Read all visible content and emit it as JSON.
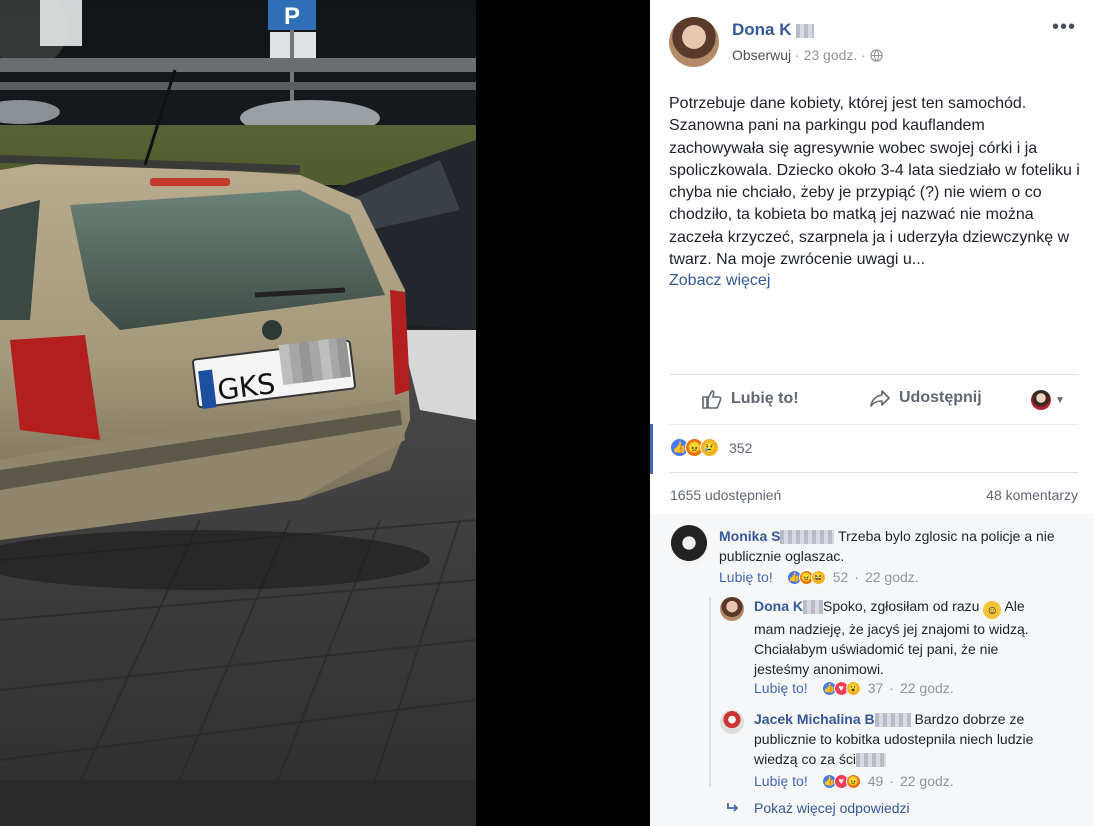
{
  "post": {
    "author_name": "Dona K",
    "follow_label": "Obserwuj",
    "time": "23 godz.",
    "text": "Potrzebuje dane kobiety, której jest ten samochód. Szanowna pani na parkingu pod kauflandem zachowywała się agresywnie wobec swojej córki i ja spoliczkowala. Dziecko około 3-4 lata siedziało w foteliku i chyba nie chciało, żeby je przypiąć (?) nie wiem o co chodziło, ta kobieta bo matką jej nazwać nie można zaczeła krzyczeć, szarpnela ja i uderzyła dziewczynkę w twarz. Na moje zwrócenie uwagi u...",
    "see_more": "Zobacz więcej",
    "like_label": "Lubię to!",
    "share_label": "Udostępnij",
    "reaction_count": "352",
    "shares_count": "1655 udostępnień",
    "comments_count": "48 komentarzy"
  },
  "photo": {
    "plate_text": "GKS",
    "sign_letter": "P"
  },
  "comments": [
    {
      "author": "Monika S",
      "text": "Trzeba bylo zglosic na policje a nie publicznie oglaszac.",
      "like_label": "Lubię to!",
      "reactions": "52",
      "time": "22 godz."
    }
  ],
  "replies": [
    {
      "author": "Dona K",
      "text_line1": "Spoko, zgłosiłam od razu",
      "text_rest": "Ale mam nadzieję, że jacyś jej znajomi to widzą. Chciałabym uświadomić tej pani, że nie jesteśmy anonimowi.",
      "like_label": "Lubię to!",
      "reactions": "37",
      "time": "22 godz."
    },
    {
      "author": "Jacek Michalina B",
      "text_line1": "Bardzo dobrze",
      "text_rest": "ze publicznie to kobitka udostepnila niech ludzie wiedzą co za ści",
      "like_label": "Lubię to!",
      "reactions": "49",
      "time": "22 godz."
    }
  ],
  "more_replies": "Pokaż więcej odpowiedzi",
  "colors": {
    "link": "#365899",
    "like_blue": "#4267b2",
    "text": "#1d2129",
    "muted": "#90949c",
    "comments_bg": "#f6f7f9"
  },
  "icons": [
    "thumbs-up-icon",
    "share-arrow-icon",
    "globe-icon",
    "more-dots-icon",
    "reply-arrow-icon",
    "smile-emoji-icon"
  ]
}
